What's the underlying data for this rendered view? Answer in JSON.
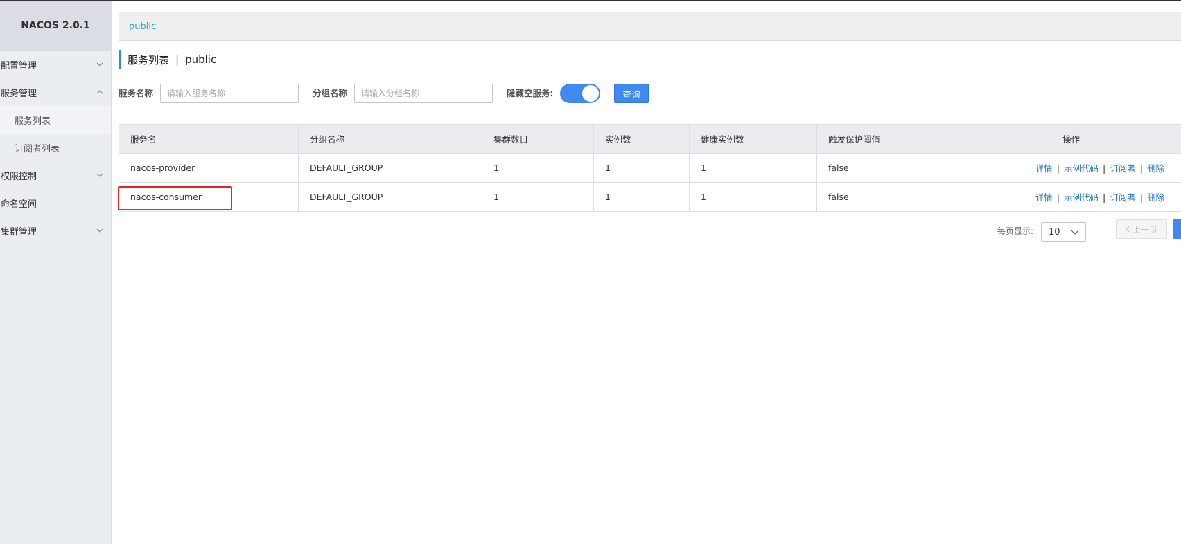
{
  "brand": {
    "title": "NACOS 2.0.1"
  },
  "sidebar": {
    "items": [
      {
        "label": "配置管理"
      },
      {
        "label": "服务管理"
      },
      {
        "label": "服务列表"
      },
      {
        "label": "订阅者列表"
      },
      {
        "label": "权限控制"
      },
      {
        "label": "命名空间"
      },
      {
        "label": "集群管理"
      }
    ]
  },
  "breadcrumb": {
    "namespace": "public"
  },
  "page": {
    "title": "服务列表",
    "separator": "|",
    "namespace": "public"
  },
  "filters": {
    "service_name_label": "服务名称",
    "service_name_placeholder": "请输入服务名称",
    "group_name_label": "分组名称",
    "group_name_placeholder": "请输入分组名称",
    "hide_empty_label": "隐藏空服务:",
    "hide_empty_on": true,
    "query_label": "查询"
  },
  "table": {
    "headers": [
      "服务名",
      "分组名称",
      "集群数目",
      "实例数",
      "健康实例数",
      "触发保护阈值",
      "操作"
    ],
    "rows": [
      {
        "service": "nacos-provider",
        "group": "DEFAULT_GROUP",
        "clusters": "1",
        "instances": "1",
        "healthy": "1",
        "threshold": "false"
      },
      {
        "service": "nacos-consumer",
        "group": "DEFAULT_GROUP",
        "clusters": "1",
        "instances": "1",
        "healthy": "1",
        "threshold": "false"
      }
    ],
    "ops": {
      "detail": "详情",
      "sample_code": "示例代码",
      "subscribers": "订阅者",
      "delete": "删除",
      "sep": "|"
    }
  },
  "pagination": {
    "page_size_label": "每页显示:",
    "page_size": "10",
    "prev_label": "上一页"
  },
  "colors": {
    "accent": "#3f89f1",
    "link": "#2273c6",
    "breadcrumb": "#1fa9c9",
    "highlight": "#e02525"
  }
}
